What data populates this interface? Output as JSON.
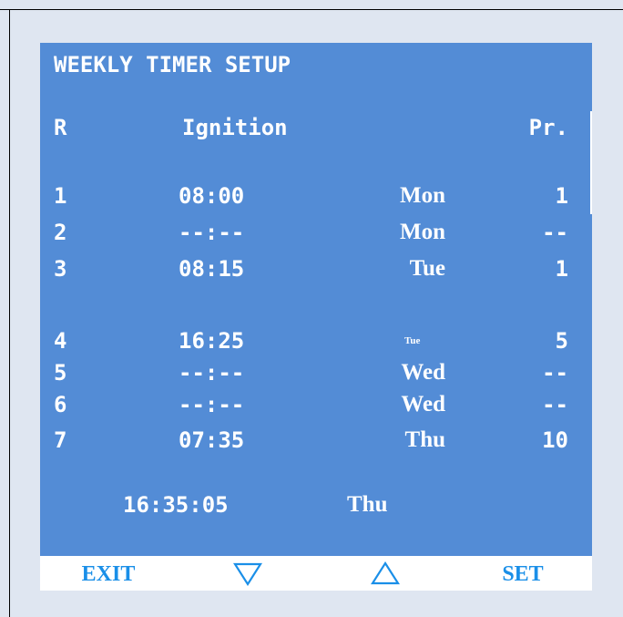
{
  "screen": {
    "title": "WEEKLY TIMER SETUP",
    "headers": {
      "row": "R",
      "ignition": "Ignition",
      "program": "Pr."
    },
    "entries": [
      {
        "row": "1",
        "time": "08:00",
        "day": "Mon",
        "program": "1"
      },
      {
        "row": "2",
        "time": "--:--",
        "day": "Mon",
        "program": "--"
      },
      {
        "row": "3",
        "time": "08:15",
        "day": "Tue",
        "program": "1"
      },
      {
        "row": "4",
        "time": "16:25",
        "day": "Tue",
        "program": "5"
      },
      {
        "row": "5",
        "time": "--:--",
        "day": "Wed",
        "program": "--"
      },
      {
        "row": "6",
        "time": "--:--",
        "day": "Wed",
        "program": "--"
      },
      {
        "row": "7",
        "time": "07:35",
        "day": "Thu",
        "program": "10"
      }
    ],
    "clock": {
      "time": "16:35:05",
      "day": "Thu"
    }
  },
  "softkeys": {
    "exit": "EXIT",
    "down_icon": "triangle-down-outline-icon",
    "up_icon": "triangle-up-outline-icon",
    "set": "SET"
  },
  "colors": {
    "screen_bg": "#538cd6",
    "screen_text": "#ffffff",
    "softkey_text": "#1a8fe8",
    "softkey_bar": "#ffffff",
    "outer_bg": "#dfe6f1"
  }
}
